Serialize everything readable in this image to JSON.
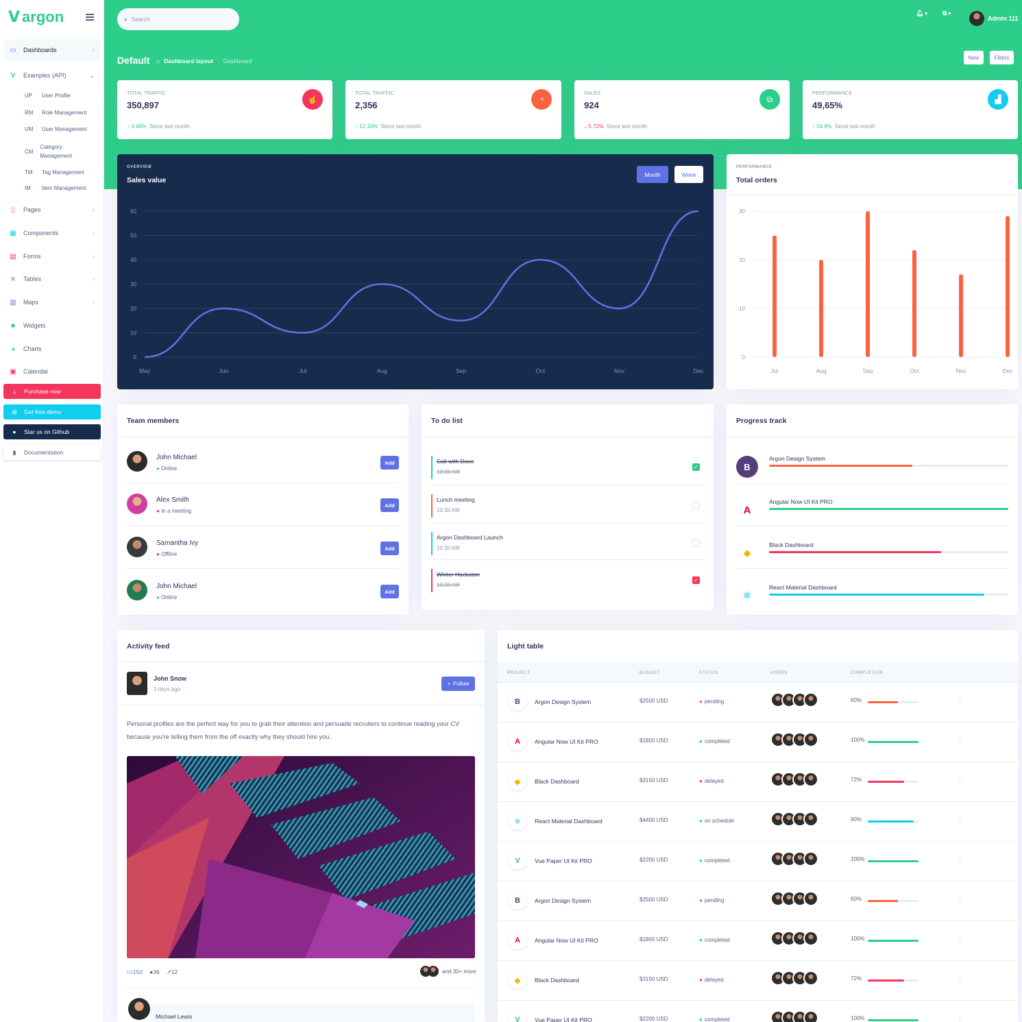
{
  "brand": {
    "logo_text": "argon"
  },
  "sidebar": {
    "items": [
      {
        "label": "Dashboards",
        "icon": "tv-icon"
      },
      {
        "label": "Examples (API)",
        "icon": "laravel-logo"
      },
      {
        "label": "Pages",
        "icon": "file-icon"
      },
      {
        "label": "Components",
        "icon": "grid-icon"
      },
      {
        "label": "Forms",
        "icon": "form-icon"
      },
      {
        "label": "Tables",
        "icon": "align-left-icon"
      },
      {
        "label": "Maps",
        "icon": "map-icon"
      },
      {
        "label": "Widgets",
        "icon": "archive-icon"
      },
      {
        "label": "Charts",
        "icon": "pie-chart-icon"
      },
      {
        "label": "Calendar",
        "icon": "calendar-icon"
      }
    ],
    "subitems": [
      {
        "abbr": "UP",
        "label": "User Profile"
      },
      {
        "abbr": "RM",
        "label": "Role Management"
      },
      {
        "abbr": "UM",
        "label": "User Management"
      },
      {
        "abbr": "CM",
        "label": "Category Management"
      },
      {
        "abbr": "TM",
        "label": "Tag Management"
      },
      {
        "abbr": "IM",
        "label": "Item Management"
      }
    ],
    "cta": [
      {
        "label": "Purchase now",
        "color": "#f5365c"
      },
      {
        "label": "Get free demo",
        "color": "#11cdef"
      },
      {
        "label": "Star us on Github",
        "color": "#172b4d"
      },
      {
        "label": "Documentation",
        "color": "#ffffff"
      }
    ]
  },
  "topbar": {
    "search_placeholder": "Search",
    "user_name": "Admin 111"
  },
  "page": {
    "title": "Default",
    "breadcrumb": [
      "Dashboard layout",
      "Dashboard"
    ],
    "buttons": [
      "New",
      "Filters"
    ]
  },
  "stats": [
    {
      "label": "Total traffic",
      "value": "350,897",
      "change": "3.48%",
      "direction": "up",
      "note": "Since last month",
      "icon_color": "#f5365c"
    },
    {
      "label": "Total traffic",
      "value": "2,356",
      "change": "12.18%",
      "direction": "up",
      "note": "Since last month",
      "icon_color": "#fb6340"
    },
    {
      "label": "Sales",
      "value": "924",
      "change": "5.72%",
      "direction": "down",
      "note": "Since last month",
      "icon_color": "#2dce89"
    },
    {
      "label": "Performance",
      "value": "49,65%",
      "change": "54.8%",
      "direction": "up",
      "note": "Since last month",
      "icon_color": "#11cdef"
    }
  ],
  "sales_chart": {
    "overline": "Overview",
    "title": "Sales value",
    "tabs": [
      "Month",
      "Week"
    ]
  },
  "orders_chart": {
    "overline": "Performance",
    "title": "Total orders"
  },
  "chart_data": [
    {
      "type": "line",
      "categories": [
        "May",
        "Jun",
        "Jul",
        "Aug",
        "Sep",
        "Oct",
        "Nov",
        "Dec"
      ],
      "series": [
        {
          "values": [
            0,
            20,
            10,
            30,
            15,
            40,
            20,
            60
          ]
        }
      ],
      "ylim": [
        0,
        60
      ],
      "yticks": [
        0,
        10,
        20,
        30,
        40,
        50,
        60
      ],
      "color": "#5e72e4",
      "grid": true
    },
    {
      "type": "bar",
      "categories": [
        "Jul",
        "Aug",
        "Sep",
        "Oct",
        "Nov",
        "Dec"
      ],
      "series": [
        {
          "values": [
            25,
            20,
            30,
            22,
            17,
            29
          ]
        }
      ],
      "ylim": [
        0,
        30
      ],
      "yticks": [
        0,
        10,
        20,
        30
      ],
      "color": "#fb6340",
      "grid": true
    }
  ],
  "team": {
    "title": "Team members",
    "add_label": "Add",
    "members": [
      {
        "name": "John Michael",
        "status": "Online",
        "status_color": "#2dce89"
      },
      {
        "name": "Alex Smith",
        "status": "In a meeting",
        "status_color": "#f5365c"
      },
      {
        "name": "Samantha Ivy",
        "status": "Offline",
        "status_color": "#f5365c"
      },
      {
        "name": "John Michael",
        "status": "Online",
        "status_color": "#2dce89"
      }
    ]
  },
  "todo": {
    "title": "To do list",
    "items": [
      {
        "title": "Call with Dave",
        "time": "10:30 AM",
        "done": true,
        "color": "#2dce89"
      },
      {
        "title": "Lunch meeting",
        "time": "10:30 AM",
        "done": false,
        "color": "#fb6340"
      },
      {
        "title": "Argon Dashboard Launch",
        "time": "10:30 AM",
        "done": false,
        "color": "#11cdef"
      },
      {
        "title": "Winter Hackaton",
        "time": "10:30 AM",
        "done": true,
        "color": "#f5365c"
      }
    ]
  },
  "progress": {
    "title": "Progress track",
    "items": [
      {
        "name": "Argon Design System",
        "value": 60,
        "color": "#fb6340",
        "logo": "B",
        "logo_color": "#563d7c"
      },
      {
        "name": "Angular Now UI Kit PRO",
        "value": 100,
        "color": "#2dce89",
        "logo": "A",
        "logo_color": "#dd0031"
      },
      {
        "name": "Black Dashboard",
        "value": 72,
        "color": "#f5365c",
        "logo": "◆",
        "logo_color": "#f7b500"
      },
      {
        "name": "React Material Dashboard",
        "value": 90,
        "color": "#11cdef",
        "logo": "⚛",
        "logo_color": "#61dafb"
      }
    ]
  },
  "feed": {
    "title": "Activity feed",
    "author": "John Snow",
    "time": "3 days ago",
    "follow": "Follow",
    "text": "Personal profiles are the perfect way for you to grab their attention and persuade recruiters to continue reading your CV because you're telling them from the off exactly why they should hire you.",
    "likes": "150",
    "comments": "36",
    "shares": "12",
    "more": "and 30+ more",
    "commenter": "Michael Lewis"
  },
  "table": {
    "title": "Light table",
    "columns": [
      "Project",
      "Budget",
      "Status",
      "Users",
      "Completion"
    ],
    "rows": [
      {
        "project": "Argon Design System",
        "budget": "$2500 USD",
        "status": "pending",
        "status_color": "#fb6340",
        "completion": 60,
        "pct": "60%",
        "color": "#fb6340",
        "logo": "B",
        "logo_color": "#563d7c"
      },
      {
        "project": "Angular Now UI Kit PRO",
        "budget": "$1800 USD",
        "status": "completed",
        "status_color": "#2dce89",
        "completion": 100,
        "pct": "100%",
        "color": "#2dce89",
        "logo": "A",
        "logo_color": "#dd0031"
      },
      {
        "project": "Black Dashboard",
        "budget": "$3150 USD",
        "status": "delayed",
        "status_color": "#f5365c",
        "completion": 72,
        "pct": "72%",
        "color": "#f5365c",
        "logo": "◆",
        "logo_color": "#f7b500"
      },
      {
        "project": "React Material Dashboard",
        "budget": "$4400 USD",
        "status": "on schedule",
        "status_color": "#11cdef",
        "completion": 90,
        "pct": "90%",
        "color": "#11cdef",
        "logo": "⚛",
        "logo_color": "#61dafb"
      },
      {
        "project": "Vue Paper UI Kit PRO",
        "budget": "$2200 USD",
        "status": "completed",
        "status_color": "#2dce89",
        "completion": 100,
        "pct": "100%",
        "color": "#2dce89",
        "logo": "V",
        "logo_color": "#41b883"
      },
      {
        "project": "Argon Design System",
        "budget": "$2500 USD",
        "status": "pending",
        "status_color": "#fb6340",
        "completion": 60,
        "pct": "60%",
        "color": "#fb6340",
        "logo": "B",
        "logo_color": "#563d7c"
      },
      {
        "project": "Angular Now UI Kit PRO",
        "budget": "$1800 USD",
        "status": "completed",
        "status_color": "#2dce89",
        "completion": 100,
        "pct": "100%",
        "color": "#2dce89",
        "logo": "A",
        "logo_color": "#dd0031"
      },
      {
        "project": "Black Dashboard",
        "budget": "$3150 USD",
        "status": "delayed",
        "status_color": "#f5365c",
        "completion": 72,
        "pct": "72%",
        "color": "#f5365c",
        "logo": "◆",
        "logo_color": "#f7b500"
      },
      {
        "project": "Vue Paper UI Kit PRO",
        "budget": "$2200 USD",
        "status": "completed",
        "status_color": "#2dce89",
        "completion": 100,
        "pct": "100%",
        "color": "#2dce89",
        "logo": "V",
        "logo_color": "#41b883"
      }
    ]
  }
}
